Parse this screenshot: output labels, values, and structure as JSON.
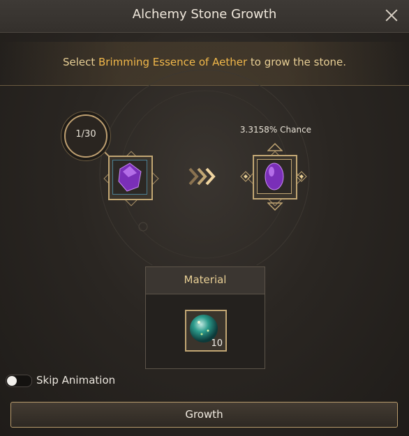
{
  "header": {
    "title": "Alchemy Stone Growth"
  },
  "instruction": {
    "prefix": "Select ",
    "highlight": "Brimming Essence of Aether",
    "suffix": " to grow the stone."
  },
  "current": {
    "counter": "1/30",
    "icon": "purple-gem-icon"
  },
  "result": {
    "chance": "3.3158% Chance",
    "icon": "purple-gem-icon"
  },
  "material": {
    "title": "Material",
    "icon": "aether-essence-orb-icon",
    "count": "10"
  },
  "skip_animation": {
    "label": "Skip Animation",
    "enabled": false
  },
  "action": {
    "growth_label": "Growth"
  },
  "colors": {
    "gold": "#f2b84a",
    "text": "#e8cf95",
    "gem": "#8a3cc8"
  }
}
